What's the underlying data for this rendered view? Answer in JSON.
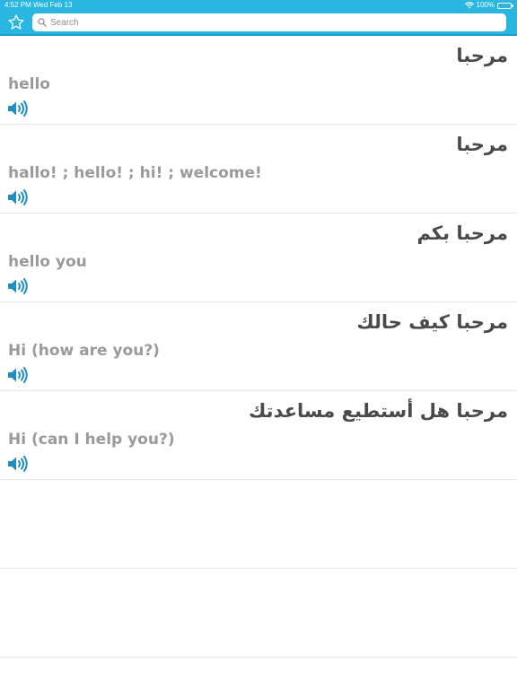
{
  "status_bar": {
    "time": "4:52 PM",
    "date": "Wed Feb 13",
    "battery": "100%",
    "battery_level": 1.0
  },
  "nav": {
    "favorites_icon": "star-icon",
    "search_icon": "search-icon",
    "search_placeholder": "Search",
    "search_value": ""
  },
  "colors": {
    "accent": "#29b6e0",
    "arabic_text": "#4a4a4a",
    "english_text": "#9a9a9a",
    "speaker": "#1f8fbf"
  },
  "results": [
    {
      "arabic": "مرحبا",
      "english": "hello",
      "icon": "speaker-icon"
    },
    {
      "arabic": "مرحبا",
      "english": "hallo! ; hello! ; hi! ; welcome!",
      "icon": "speaker-icon"
    },
    {
      "arabic": "مرحبا بكم",
      "english": "hello you",
      "icon": "speaker-icon"
    },
    {
      "arabic": "مرحبا كيف حالك",
      "english": "Hi (how are you?)",
      "icon": "speaker-icon"
    },
    {
      "arabic": "مرحبا هل أستطيع مساعدتك",
      "english": "Hi (can I help you?)",
      "icon": "speaker-icon"
    }
  ]
}
